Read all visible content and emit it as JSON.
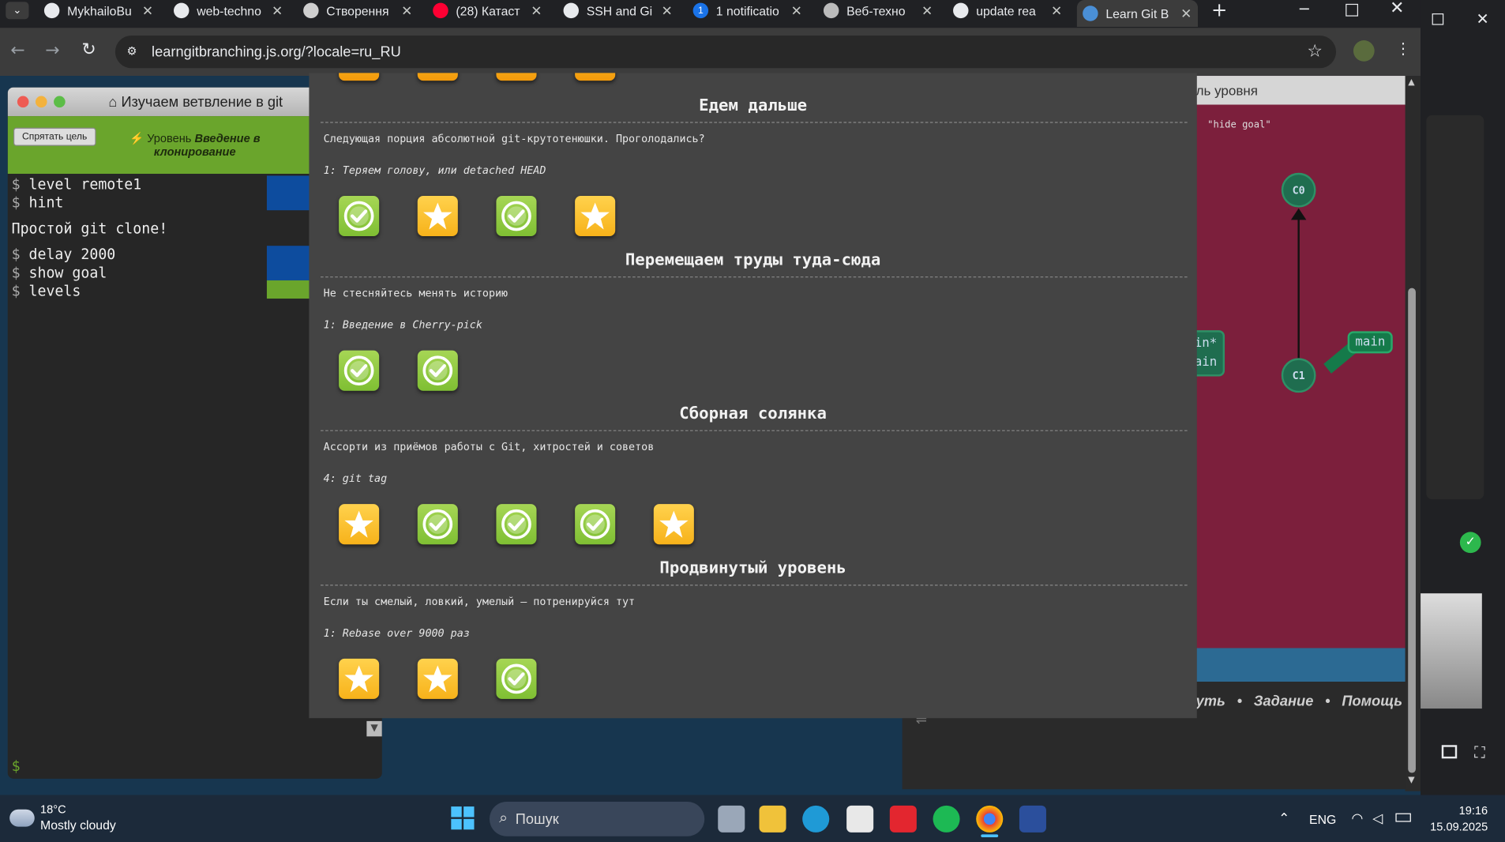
{
  "browser": {
    "tabs": [
      {
        "title": "MykhailoBu",
        "icon": "github-icon"
      },
      {
        "title": "web-techno",
        "icon": "github-icon"
      },
      {
        "title": "Створення",
        "icon": "chatgpt-icon"
      },
      {
        "title": "(28) Катаст",
        "icon": "youtube-icon"
      },
      {
        "title": "SSH and Gi",
        "icon": "github-icon"
      },
      {
        "title": "1 notificatio",
        "icon": "notification-icon",
        "badge": "1"
      },
      {
        "title": "Веб-техно",
        "icon": "globe-icon"
      },
      {
        "title": "update rea",
        "icon": "github-icon"
      },
      {
        "title": "Learn Git B",
        "icon": "learngit-icon",
        "active": true
      }
    ],
    "new_tab": "+",
    "url": "learngitbranching.js.org/?locale=ru_RU"
  },
  "command_window": {
    "title": "Изучаем ветвление в git",
    "hide_goal_label": "Спрятать цель",
    "level_prefix": "Уровень",
    "level_name": "Введение в клонирование",
    "lines": [
      {
        "prompt": "$",
        "text": "level remote1"
      },
      {
        "prompt": "$",
        "text": "hint"
      },
      {
        "prompt": "",
        "text": "Простой git clone!"
      },
      {
        "prompt": "$",
        "text": "delay 2000"
      },
      {
        "prompt": "$",
        "text": "show goal"
      },
      {
        "prompt": "$",
        "text": "levels"
      }
    ],
    "input_prompt": "$"
  },
  "goal_panel": {
    "header": "ль уровня",
    "hint": "\"hide goal\"",
    "commits": [
      "C0",
      "C1"
    ],
    "branch_label": "main",
    "partial_labels": [
      "in*",
      "ain"
    ]
  },
  "help_links": [
    "уть",
    "Задание",
    "Помощь"
  ],
  "modal": {
    "sections": [
      {
        "title": "Едем дальше",
        "description": "Следующая порция абсолютной git-крутотенюшки. Проголодались?",
        "subtitle": "1: Теряем голову, или detached HEAD",
        "levels": [
          "check",
          "star",
          "check",
          "star"
        ]
      },
      {
        "title": "Перемещаем труды туда-сюда",
        "description": "Не стесняйтесь менять историю",
        "subtitle": "1: Введение в Cherry-pick",
        "levels": [
          "check",
          "check"
        ]
      },
      {
        "title": "Сборная солянка",
        "description": "Ассорти из приёмов работы с Git, хитростей и советов",
        "subtitle": "4: git tag",
        "levels": [
          "star",
          "check",
          "check",
          "check",
          "star"
        ]
      },
      {
        "title": "Продвинутый уровень",
        "description": "Если ты смелый, ловкий, умелый – потренируйся тут",
        "subtitle": "1: Rebase over 9000 раз",
        "levels": [
          "star",
          "star",
          "check"
        ]
      }
    ]
  },
  "taskbar": {
    "weather_temp": "18°C",
    "weather_desc": "Mostly cloudy",
    "search_placeholder": "Пошук",
    "language": "ENG",
    "time": "19:16",
    "date": "15.09.2025"
  },
  "colors": {
    "check": "#7fbf33",
    "star": "#f7b21a",
    "goal_bg": "#7c1f3c",
    "modal_bg": "#444444"
  }
}
